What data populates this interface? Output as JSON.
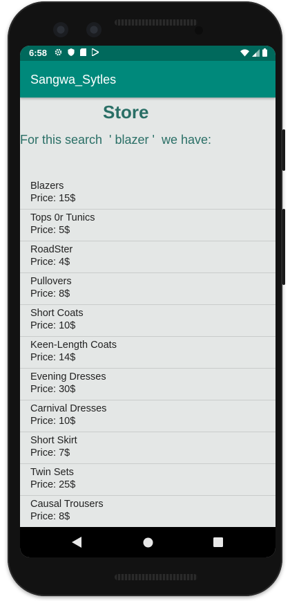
{
  "status_bar": {
    "time": "6:58",
    "icons": [
      "gear-icon",
      "shield-icon",
      "sd-card-icon",
      "play-store-icon"
    ],
    "right_icons": [
      "wifi-icon",
      "signal-icon",
      "battery-icon"
    ]
  },
  "app_bar": {
    "title": "Sangwa_Sytles"
  },
  "main": {
    "heading": "Store",
    "search_text": "For this search  ' blazer '  we have:",
    "items": [
      {
        "name": "Blazers",
        "price": "Price: 15$"
      },
      {
        "name": "Tops 0r Tunics",
        "price": "Price: 5$"
      },
      {
        "name": "RoadSter",
        "price": "Price: 4$"
      },
      {
        "name": "Pullovers",
        "price": "Price: 8$"
      },
      {
        "name": "Short Coats",
        "price": "Price: 10$"
      },
      {
        "name": "Keen-Length Coats",
        "price": "Price: 14$"
      },
      {
        "name": "Evening Dresses",
        "price": "Price: 30$"
      },
      {
        "name": "Carnival Dresses",
        "price": "Price: 10$"
      },
      {
        "name": "Short Skirt",
        "price": "Price: 7$"
      },
      {
        "name": "Twin Sets",
        "price": "Price: 25$"
      },
      {
        "name": "Causal Trousers",
        "price": "Price: 8$"
      }
    ]
  },
  "nav_bar": {
    "buttons": [
      "back-icon",
      "home-icon",
      "recents-icon"
    ]
  },
  "colors": {
    "status_bar": "#00695c",
    "app_bar": "#00897b",
    "accent_text": "#2a6f66",
    "background": "#e4e7e6"
  }
}
